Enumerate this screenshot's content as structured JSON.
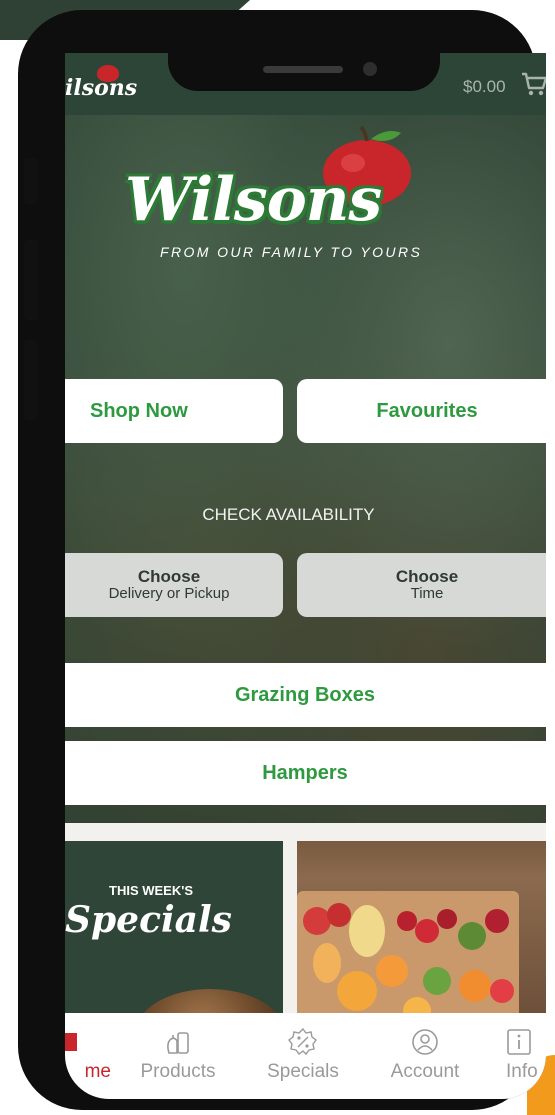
{
  "app": {
    "brand": "Wilsons",
    "cart_total": "$0.00"
  },
  "hero": {
    "logo_text": "Wilsons",
    "tagline": "FROM OUR FAMILY TO YOURS"
  },
  "mini_logo": "ilsons",
  "actions": {
    "shop_now": "Shop Now",
    "favourites": "Favourites"
  },
  "availability": {
    "title": "CHECK AVAILABILITY",
    "delivery_main": "Choose",
    "delivery_sub": "Delivery or Pickup",
    "time_main": "Choose",
    "time_sub": "Time"
  },
  "categories": {
    "grazing": "Grazing Boxes",
    "hampers": "Hampers"
  },
  "promo": {
    "kicker": "THIS WEEK'S",
    "title": "Specials"
  },
  "tabs": [
    {
      "label": "me",
      "icon": "home-icon",
      "active": true
    },
    {
      "label": "Products",
      "icon": "products-icon"
    },
    {
      "label": "Specials",
      "icon": "percent-tag-icon"
    },
    {
      "label": "Account",
      "icon": "account-icon"
    },
    {
      "label": "Info",
      "icon": "info-icon"
    }
  ],
  "colors": {
    "brand_green": "#2e9a3f",
    "dark_green": "#2f4538",
    "apple_red": "#c9262b",
    "accent_orange": "#f29a1c"
  }
}
